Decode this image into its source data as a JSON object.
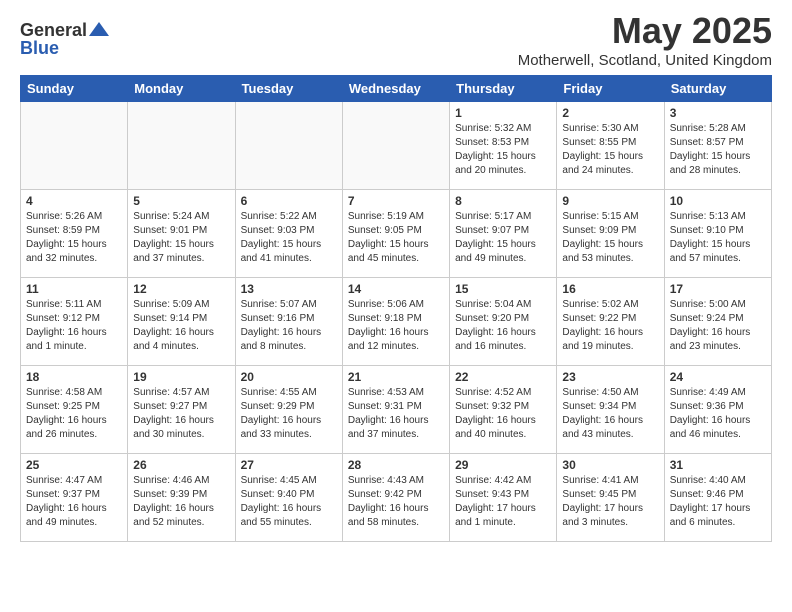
{
  "header": {
    "logo_general": "General",
    "logo_blue": "Blue",
    "month_title": "May 2025",
    "location": "Motherwell, Scotland, United Kingdom"
  },
  "weekdays": [
    "Sunday",
    "Monday",
    "Tuesday",
    "Wednesday",
    "Thursday",
    "Friday",
    "Saturday"
  ],
  "weeks": [
    [
      {
        "day": "",
        "info": ""
      },
      {
        "day": "",
        "info": ""
      },
      {
        "day": "",
        "info": ""
      },
      {
        "day": "",
        "info": ""
      },
      {
        "day": "1",
        "info": "Sunrise: 5:32 AM\nSunset: 8:53 PM\nDaylight: 15 hours\nand 20 minutes."
      },
      {
        "day": "2",
        "info": "Sunrise: 5:30 AM\nSunset: 8:55 PM\nDaylight: 15 hours\nand 24 minutes."
      },
      {
        "day": "3",
        "info": "Sunrise: 5:28 AM\nSunset: 8:57 PM\nDaylight: 15 hours\nand 28 minutes."
      }
    ],
    [
      {
        "day": "4",
        "info": "Sunrise: 5:26 AM\nSunset: 8:59 PM\nDaylight: 15 hours\nand 32 minutes."
      },
      {
        "day": "5",
        "info": "Sunrise: 5:24 AM\nSunset: 9:01 PM\nDaylight: 15 hours\nand 37 minutes."
      },
      {
        "day": "6",
        "info": "Sunrise: 5:22 AM\nSunset: 9:03 PM\nDaylight: 15 hours\nand 41 minutes."
      },
      {
        "day": "7",
        "info": "Sunrise: 5:19 AM\nSunset: 9:05 PM\nDaylight: 15 hours\nand 45 minutes."
      },
      {
        "day": "8",
        "info": "Sunrise: 5:17 AM\nSunset: 9:07 PM\nDaylight: 15 hours\nand 49 minutes."
      },
      {
        "day": "9",
        "info": "Sunrise: 5:15 AM\nSunset: 9:09 PM\nDaylight: 15 hours\nand 53 minutes."
      },
      {
        "day": "10",
        "info": "Sunrise: 5:13 AM\nSunset: 9:10 PM\nDaylight: 15 hours\nand 57 minutes."
      }
    ],
    [
      {
        "day": "11",
        "info": "Sunrise: 5:11 AM\nSunset: 9:12 PM\nDaylight: 16 hours\nand 1 minute."
      },
      {
        "day": "12",
        "info": "Sunrise: 5:09 AM\nSunset: 9:14 PM\nDaylight: 16 hours\nand 4 minutes."
      },
      {
        "day": "13",
        "info": "Sunrise: 5:07 AM\nSunset: 9:16 PM\nDaylight: 16 hours\nand 8 minutes."
      },
      {
        "day": "14",
        "info": "Sunrise: 5:06 AM\nSunset: 9:18 PM\nDaylight: 16 hours\nand 12 minutes."
      },
      {
        "day": "15",
        "info": "Sunrise: 5:04 AM\nSunset: 9:20 PM\nDaylight: 16 hours\nand 16 minutes."
      },
      {
        "day": "16",
        "info": "Sunrise: 5:02 AM\nSunset: 9:22 PM\nDaylight: 16 hours\nand 19 minutes."
      },
      {
        "day": "17",
        "info": "Sunrise: 5:00 AM\nSunset: 9:24 PM\nDaylight: 16 hours\nand 23 minutes."
      }
    ],
    [
      {
        "day": "18",
        "info": "Sunrise: 4:58 AM\nSunset: 9:25 PM\nDaylight: 16 hours\nand 26 minutes."
      },
      {
        "day": "19",
        "info": "Sunrise: 4:57 AM\nSunset: 9:27 PM\nDaylight: 16 hours\nand 30 minutes."
      },
      {
        "day": "20",
        "info": "Sunrise: 4:55 AM\nSunset: 9:29 PM\nDaylight: 16 hours\nand 33 minutes."
      },
      {
        "day": "21",
        "info": "Sunrise: 4:53 AM\nSunset: 9:31 PM\nDaylight: 16 hours\nand 37 minutes."
      },
      {
        "day": "22",
        "info": "Sunrise: 4:52 AM\nSunset: 9:32 PM\nDaylight: 16 hours\nand 40 minutes."
      },
      {
        "day": "23",
        "info": "Sunrise: 4:50 AM\nSunset: 9:34 PM\nDaylight: 16 hours\nand 43 minutes."
      },
      {
        "day": "24",
        "info": "Sunrise: 4:49 AM\nSunset: 9:36 PM\nDaylight: 16 hours\nand 46 minutes."
      }
    ],
    [
      {
        "day": "25",
        "info": "Sunrise: 4:47 AM\nSunset: 9:37 PM\nDaylight: 16 hours\nand 49 minutes."
      },
      {
        "day": "26",
        "info": "Sunrise: 4:46 AM\nSunset: 9:39 PM\nDaylight: 16 hours\nand 52 minutes."
      },
      {
        "day": "27",
        "info": "Sunrise: 4:45 AM\nSunset: 9:40 PM\nDaylight: 16 hours\nand 55 minutes."
      },
      {
        "day": "28",
        "info": "Sunrise: 4:43 AM\nSunset: 9:42 PM\nDaylight: 16 hours\nand 58 minutes."
      },
      {
        "day": "29",
        "info": "Sunrise: 4:42 AM\nSunset: 9:43 PM\nDaylight: 17 hours\nand 1 minute."
      },
      {
        "day": "30",
        "info": "Sunrise: 4:41 AM\nSunset: 9:45 PM\nDaylight: 17 hours\nand 3 minutes."
      },
      {
        "day": "31",
        "info": "Sunrise: 4:40 AM\nSunset: 9:46 PM\nDaylight: 17 hours\nand 6 minutes."
      }
    ]
  ]
}
